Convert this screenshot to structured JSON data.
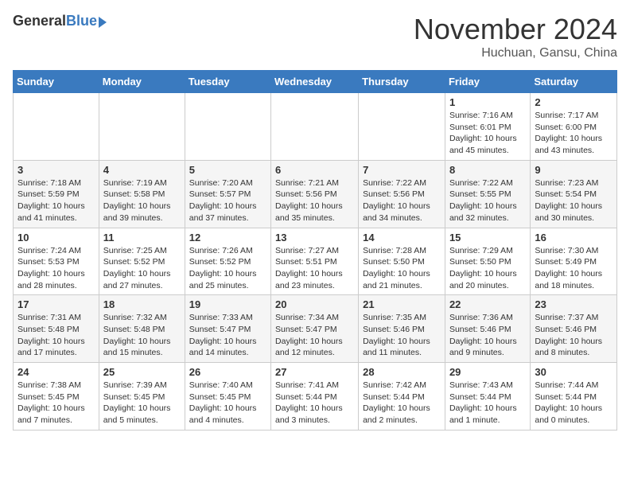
{
  "header": {
    "logo_general": "General",
    "logo_blue": "Blue",
    "month": "November 2024",
    "location": "Huchuan, Gansu, China"
  },
  "columns": [
    "Sunday",
    "Monday",
    "Tuesday",
    "Wednesday",
    "Thursday",
    "Friday",
    "Saturday"
  ],
  "weeks": [
    [
      {
        "day": "",
        "info": ""
      },
      {
        "day": "",
        "info": ""
      },
      {
        "day": "",
        "info": ""
      },
      {
        "day": "",
        "info": ""
      },
      {
        "day": "",
        "info": ""
      },
      {
        "day": "1",
        "info": "Sunrise: 7:16 AM\nSunset: 6:01 PM\nDaylight: 10 hours and 45 minutes."
      },
      {
        "day": "2",
        "info": "Sunrise: 7:17 AM\nSunset: 6:00 PM\nDaylight: 10 hours and 43 minutes."
      }
    ],
    [
      {
        "day": "3",
        "info": "Sunrise: 7:18 AM\nSunset: 5:59 PM\nDaylight: 10 hours and 41 minutes."
      },
      {
        "day": "4",
        "info": "Sunrise: 7:19 AM\nSunset: 5:58 PM\nDaylight: 10 hours and 39 minutes."
      },
      {
        "day": "5",
        "info": "Sunrise: 7:20 AM\nSunset: 5:57 PM\nDaylight: 10 hours and 37 minutes."
      },
      {
        "day": "6",
        "info": "Sunrise: 7:21 AM\nSunset: 5:56 PM\nDaylight: 10 hours and 35 minutes."
      },
      {
        "day": "7",
        "info": "Sunrise: 7:22 AM\nSunset: 5:56 PM\nDaylight: 10 hours and 34 minutes."
      },
      {
        "day": "8",
        "info": "Sunrise: 7:22 AM\nSunset: 5:55 PM\nDaylight: 10 hours and 32 minutes."
      },
      {
        "day": "9",
        "info": "Sunrise: 7:23 AM\nSunset: 5:54 PM\nDaylight: 10 hours and 30 minutes."
      }
    ],
    [
      {
        "day": "10",
        "info": "Sunrise: 7:24 AM\nSunset: 5:53 PM\nDaylight: 10 hours and 28 minutes."
      },
      {
        "day": "11",
        "info": "Sunrise: 7:25 AM\nSunset: 5:52 PM\nDaylight: 10 hours and 27 minutes."
      },
      {
        "day": "12",
        "info": "Sunrise: 7:26 AM\nSunset: 5:52 PM\nDaylight: 10 hours and 25 minutes."
      },
      {
        "day": "13",
        "info": "Sunrise: 7:27 AM\nSunset: 5:51 PM\nDaylight: 10 hours and 23 minutes."
      },
      {
        "day": "14",
        "info": "Sunrise: 7:28 AM\nSunset: 5:50 PM\nDaylight: 10 hours and 21 minutes."
      },
      {
        "day": "15",
        "info": "Sunrise: 7:29 AM\nSunset: 5:50 PM\nDaylight: 10 hours and 20 minutes."
      },
      {
        "day": "16",
        "info": "Sunrise: 7:30 AM\nSunset: 5:49 PM\nDaylight: 10 hours and 18 minutes."
      }
    ],
    [
      {
        "day": "17",
        "info": "Sunrise: 7:31 AM\nSunset: 5:48 PM\nDaylight: 10 hours and 17 minutes."
      },
      {
        "day": "18",
        "info": "Sunrise: 7:32 AM\nSunset: 5:48 PM\nDaylight: 10 hours and 15 minutes."
      },
      {
        "day": "19",
        "info": "Sunrise: 7:33 AM\nSunset: 5:47 PM\nDaylight: 10 hours and 14 minutes."
      },
      {
        "day": "20",
        "info": "Sunrise: 7:34 AM\nSunset: 5:47 PM\nDaylight: 10 hours and 12 minutes."
      },
      {
        "day": "21",
        "info": "Sunrise: 7:35 AM\nSunset: 5:46 PM\nDaylight: 10 hours and 11 minutes."
      },
      {
        "day": "22",
        "info": "Sunrise: 7:36 AM\nSunset: 5:46 PM\nDaylight: 10 hours and 9 minutes."
      },
      {
        "day": "23",
        "info": "Sunrise: 7:37 AM\nSunset: 5:46 PM\nDaylight: 10 hours and 8 minutes."
      }
    ],
    [
      {
        "day": "24",
        "info": "Sunrise: 7:38 AM\nSunset: 5:45 PM\nDaylight: 10 hours and 7 minutes."
      },
      {
        "day": "25",
        "info": "Sunrise: 7:39 AM\nSunset: 5:45 PM\nDaylight: 10 hours and 5 minutes."
      },
      {
        "day": "26",
        "info": "Sunrise: 7:40 AM\nSunset: 5:45 PM\nDaylight: 10 hours and 4 minutes."
      },
      {
        "day": "27",
        "info": "Sunrise: 7:41 AM\nSunset: 5:44 PM\nDaylight: 10 hours and 3 minutes."
      },
      {
        "day": "28",
        "info": "Sunrise: 7:42 AM\nSunset: 5:44 PM\nDaylight: 10 hours and 2 minutes."
      },
      {
        "day": "29",
        "info": "Sunrise: 7:43 AM\nSunset: 5:44 PM\nDaylight: 10 hours and 1 minute."
      },
      {
        "day": "30",
        "info": "Sunrise: 7:44 AM\nSunset: 5:44 PM\nDaylight: 10 hours and 0 minutes."
      }
    ]
  ]
}
